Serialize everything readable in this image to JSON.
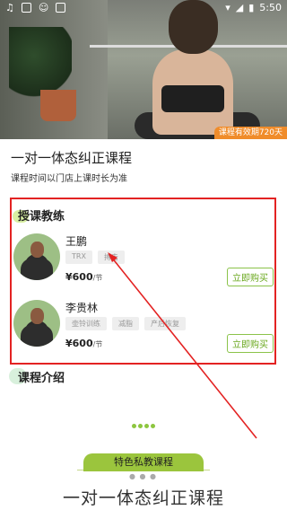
{
  "status_bar": {
    "time": "5:50",
    "icons": [
      "music-icon",
      "image-icon",
      "face-icon",
      "a-icon",
      "wifi-icon",
      "signal-icon",
      "battery-icon"
    ]
  },
  "hero": {
    "badge": "课程有效期720天"
  },
  "course": {
    "title": "一对一体态纠正课程",
    "subtitle": "课程时间以门店上课时长为准"
  },
  "coaches_section": {
    "title": "授课教练",
    "coaches": [
      {
        "name": "王鹏",
        "tags": [
          "TRX",
          "搏击"
        ],
        "price": "¥600",
        "unit": "/节",
        "buy_label": "立即购买"
      },
      {
        "name": "李贵林",
        "tags": [
          "壶铃训练",
          "减脂",
          "产后恢复"
        ],
        "price": "¥600",
        "unit": "/节",
        "buy_label": "立即购买"
      }
    ]
  },
  "intro": {
    "title": "课程介绍"
  },
  "promo": {
    "label": "特色私教课程",
    "big_title": "一对一体态纠正课程"
  },
  "colors": {
    "accent": "#8dc63f",
    "badge": "#f08c2a",
    "highlight_box": "#e32222"
  }
}
